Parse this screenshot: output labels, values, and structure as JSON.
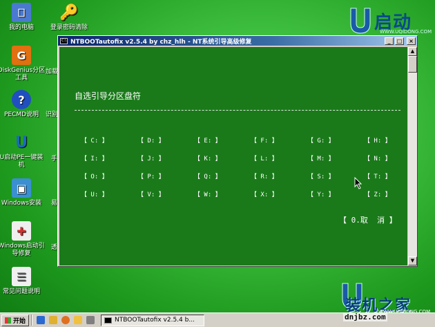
{
  "desktop_icons": [
    {
      "label": "我的电脑",
      "icon": "computer-icon",
      "color": "#4a7ad0"
    },
    {
      "label": "登录密码清除",
      "icon": "key-icon",
      "color": "#e0b000"
    },
    {
      "label": "DiskGenius分区工具",
      "icon": "diskgenius-icon",
      "color": "#e07010"
    },
    {
      "label": "PECMD说明",
      "icon": "help-icon",
      "color": "#2050c0"
    },
    {
      "label": "U启动PE一键装机",
      "icon": "uqidong-icon",
      "color": "#1a6ac0"
    },
    {
      "label": "Windows安装",
      "icon": "windows-install-icon",
      "color": "#3a90d0"
    },
    {
      "label": "Windows启动引导修复",
      "icon": "boot-repair-icon",
      "color": "#d03030"
    },
    {
      "label": "常见问题说明",
      "icon": "document-icon",
      "color": "#f0f0f0"
    }
  ],
  "partial_labels": [
    "加载",
    "识别",
    "手",
    "易",
    "透"
  ],
  "logo": {
    "text": "启动",
    "letter": "U",
    "sub": "WWW.UQIDONG.COM"
  },
  "window": {
    "title": "NTBOOTautofix v2.5.4 by chz_hlh - NT系统引导高级修复",
    "minimize": "_",
    "maximize": "□",
    "close": "×",
    "icon_label": "C:\\"
  },
  "console": {
    "heading": "自选引导分区盘符",
    "drives": [
      "【 C: 】",
      "【 D: 】",
      "【 E: 】",
      "【 F: 】",
      "【 G: 】",
      "【 H: 】",
      "【 I: 】",
      "【 J: 】",
      "【 K: 】",
      "【 L: 】",
      "【 M: 】",
      "【 N: 】",
      "【 O: 】",
      "【 P: 】",
      "【 Q: 】",
      "【 R: 】",
      "【 S: 】",
      "【 T: 】",
      "【 U: 】",
      "【 V: 】",
      "【 W: 】",
      "【 X: 】",
      "【 Y: 】",
      "【 Z: 】"
    ],
    "cancel": "【 0.取  消 】"
  },
  "taskbar": {
    "start_label": "开始",
    "task_label": "NTBOOTautofix v2.5.4 b...",
    "quick_launch": [
      "ie-icon",
      "explorer-icon",
      "media-icon",
      "folder-icon",
      "tools-icon"
    ]
  },
  "watermark": {
    "title": "装机之家",
    "url": "dnjbz.com",
    "small": "WWW.UQIDONG.COM"
  }
}
